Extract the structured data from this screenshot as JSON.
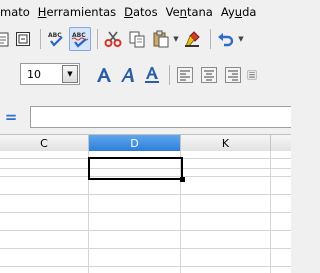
{
  "menubar": {
    "items": [
      {
        "pre": "",
        "key": "",
        "post": "mato"
      },
      {
        "pre": "",
        "key": "H",
        "post": "erramientas"
      },
      {
        "pre": "",
        "key": "D",
        "post": "atos"
      },
      {
        "pre": "Ve",
        "key": "n",
        "post": "tana"
      },
      {
        "pre": "Ay",
        "key": "u",
        "post": "da"
      }
    ]
  },
  "formatting": {
    "font_size": "10"
  },
  "formula_bar": {
    "symbol": "=",
    "value": ""
  },
  "columns": [
    {
      "label": "C",
      "selected": false
    },
    {
      "label": "D",
      "selected": true
    },
    {
      "label": "K",
      "selected": false
    }
  ],
  "colors": {
    "selected_column_header": "#2e7fd9",
    "formula_symbol": "#2e6fd1",
    "spellcheck": "#2a64c8",
    "cut": "#d9302a",
    "fill_color": "#e8c21a",
    "font_color": "#e03a2c",
    "undo": "#2f6cc7"
  }
}
